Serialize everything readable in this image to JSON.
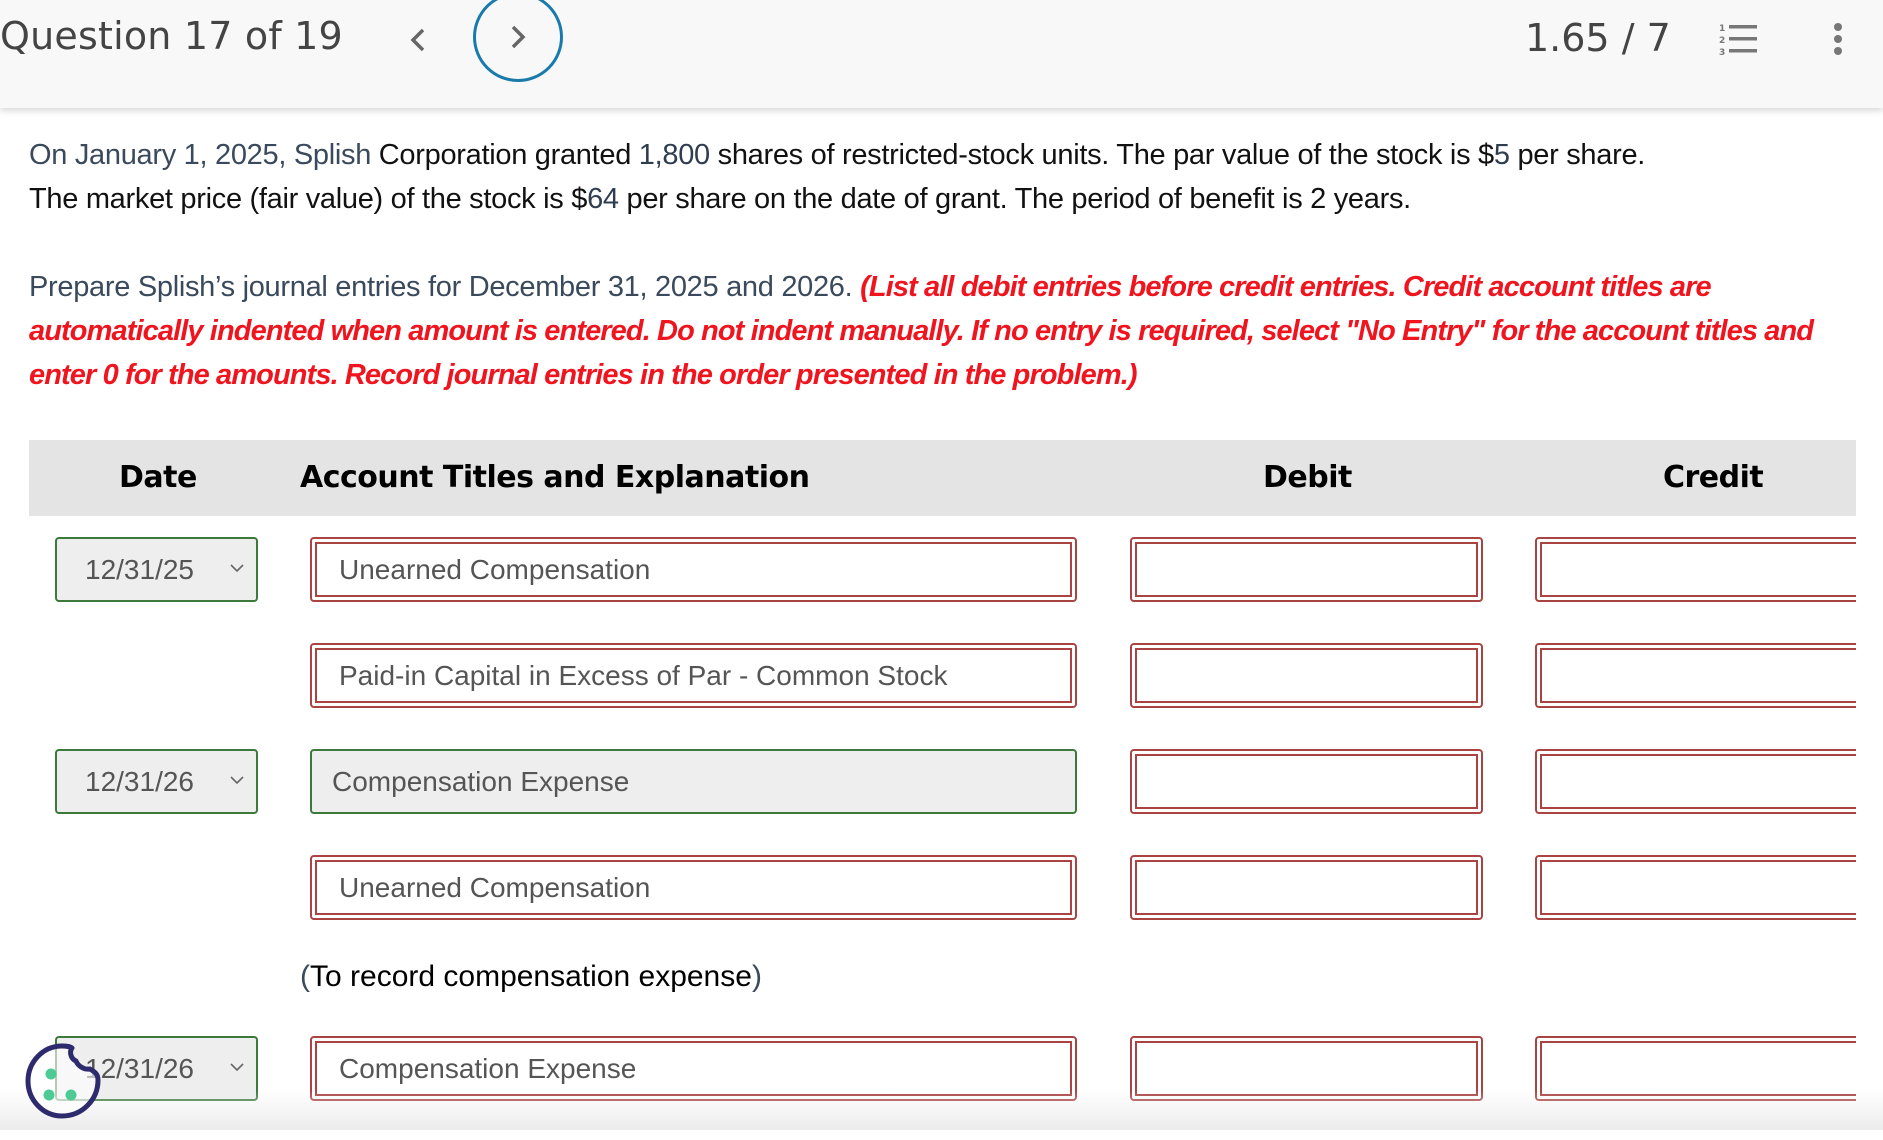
{
  "header": {
    "question_label": "Question 17 of 19",
    "score": "1.65 / 7",
    "prev_icon": "chevron-left-icon",
    "next_icon": "chevron-right-icon",
    "list_icon": "numbered-list-icon",
    "more_icon": "more-vertical-icon"
  },
  "question": {
    "p1": {
      "s1": "On January 1, 2025, Splish",
      "s2": " Corporation granted ",
      "shares": "1,800",
      "s3": " shares of restricted-stock units. The par value of the stock is $",
      "par": "5",
      "s4": " per share.",
      "s5": "The market price (fair value) of the stock is $",
      "price": "64",
      "s6": " per share on the date of grant. The period of benefit is 2 years."
    },
    "p2": {
      "lead": "Prepare Splish’s journal entries for December 31, 2025 and 2026. ",
      "instructions": "(List all debit entries before credit entries. Credit account titles are automatically indented when amount is entered. Do not indent manually. If no entry is required, select \"No Entry\" for the account titles and enter 0 for the amounts. Record journal entries in the order presented in the problem.)"
    }
  },
  "table": {
    "headers": {
      "date": "Date",
      "account": "Account Titles and Explanation",
      "debit": "Debit",
      "credit": "Credit"
    },
    "rows": [
      {
        "date": "12/31/25",
        "account": "Unearned Compensation",
        "account_status": "incorrect",
        "debit": "",
        "credit": ""
      },
      {
        "date": null,
        "account": "Paid-in Capital in Excess of Par - Common Stock",
        "account_status": "incorrect",
        "debit": "",
        "credit": ""
      },
      {
        "date": "12/31/26",
        "account": "Compensation Expense",
        "account_status": "correct",
        "debit": "",
        "credit": ""
      },
      {
        "date": null,
        "account": "Unearned Compensation",
        "account_status": "incorrect",
        "debit": "",
        "credit": ""
      },
      {
        "date": "12/31/26",
        "account": "Compensation Expense",
        "account_status": "incorrect",
        "debit": "",
        "credit": ""
      }
    ],
    "explanation_open": "(",
    "explanation_text": "To record compensation expense",
    "explanation_close": ")"
  },
  "colors": {
    "accent_blue": "#1a7aab",
    "incorrect_red": "#a94442",
    "correct_green": "#3c7a3c",
    "instruction_red": "#f0141e"
  },
  "cookie_icon": "cookie-settings-icon"
}
